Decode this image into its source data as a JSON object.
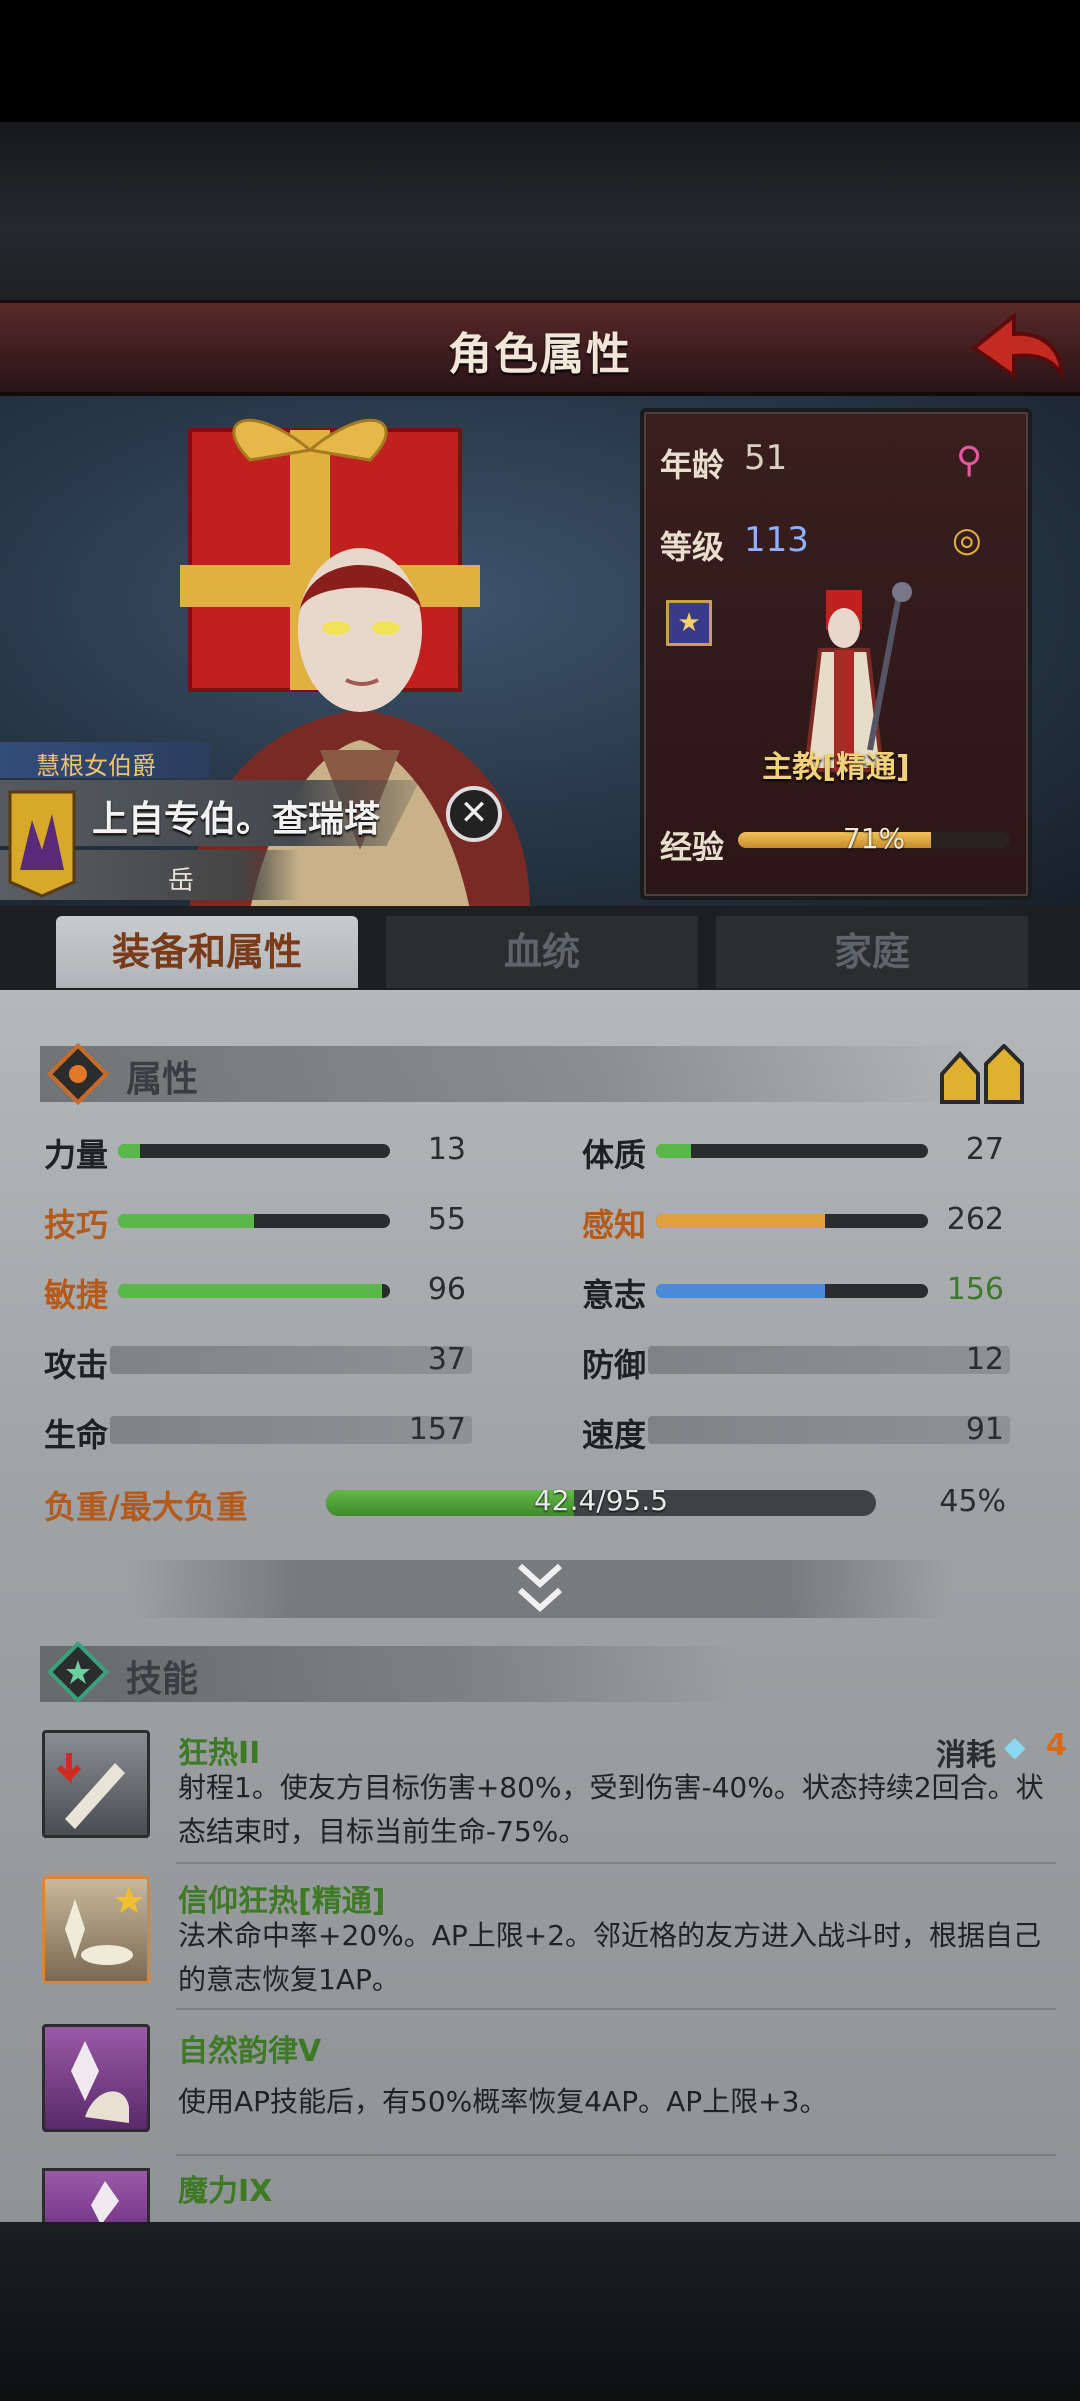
{
  "header": {
    "title": "角色属性",
    "back_icon": "back-arrow-icon"
  },
  "character": {
    "title_badge": "慧根女伯爵",
    "name": "上自专伯。查瑞塔",
    "sub": "岳",
    "age_label": "年龄",
    "age": "51",
    "level_label": "等级",
    "level": "113",
    "class_name": "主教[精通]",
    "exp_label": "经验",
    "exp_text": "71%",
    "exp_fraction": 0.71
  },
  "tabs": [
    "装备和属性",
    "血统",
    "家庭"
  ],
  "attributes": {
    "section_title": "属性",
    "stats": [
      {
        "label": "力量",
        "value": "13",
        "fill": 0.08,
        "color": "#5ab84a"
      },
      {
        "label": "体质",
        "value": "27",
        "fill": 0.13,
        "color": "#5ab84a"
      },
      {
        "label": "技巧",
        "value": "55",
        "fill": 0.5,
        "color": "#5ab84a"
      },
      {
        "label": "感知",
        "value": "262",
        "fill": 0.62,
        "color": "#e0a040"
      },
      {
        "label": "敏捷",
        "value": "96",
        "fill": 0.97,
        "color": "#5ab84a"
      },
      {
        "label": "意志",
        "value": "156",
        "fill": 0.62,
        "color": "#4a8ad8"
      }
    ],
    "plain_stats": [
      {
        "label": "攻击",
        "value": "37"
      },
      {
        "label": "防御",
        "value": "12"
      },
      {
        "label": "生命",
        "value": "157"
      },
      {
        "label": "速度",
        "value": "91"
      }
    ],
    "load_label": "负重/最大负重",
    "load_text": "42.4/95.5",
    "load_percent": "45%",
    "load_fraction": 0.45
  },
  "skills": {
    "section_title": "技能",
    "cost_label": "消耗",
    "cost_value": "4",
    "items": [
      {
        "name": "狂热II",
        "desc1": "射程1。使友方目标伤害+80%，受到伤害-40%。状态持续2回合。状",
        "desc2": "态结束时，目标当前生命-75%。"
      },
      {
        "name": "信仰狂热[精通]",
        "desc1": "法术命中率+20%。AP上限+2。邻近格的友方进入战斗时，根据自己",
        "desc2": "的意志恢复1AP。"
      },
      {
        "name": "自然韵律V",
        "desc1": "使用AP技能后，有50%概率恢复4AP。AP上限+3。",
        "desc2": ""
      },
      {
        "name": "魔力IX",
        "desc1": "",
        "desc2": ""
      }
    ]
  }
}
